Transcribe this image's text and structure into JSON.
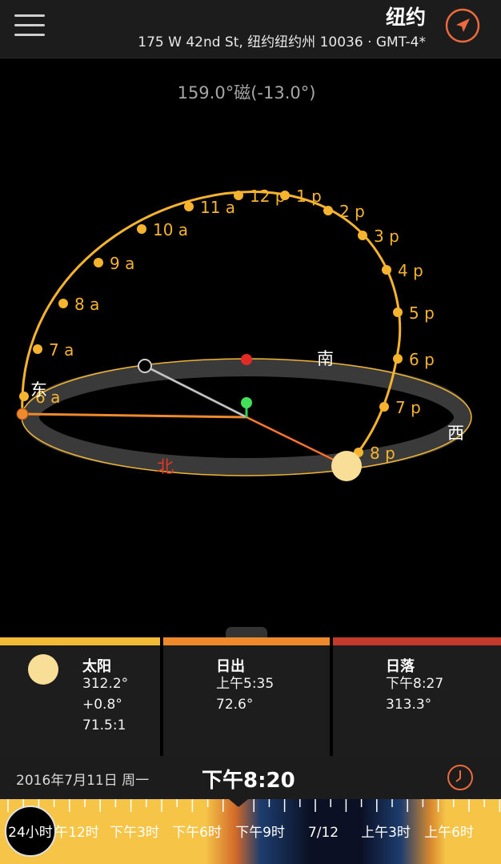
{
  "header": {
    "location_title": "纽约",
    "address": "175 W 42nd St, 纽约纽约州 10036 · GMT-4*",
    "menu_icon": "hamburger-menu-icon",
    "locate_icon": "location-arrow-icon"
  },
  "compass": {
    "heading": "159.0°磁(-13.0°)",
    "directions": {
      "south": "南",
      "west": "西",
      "north": "北",
      "east": "东"
    }
  },
  "sun_path": {
    "hour_labels": [
      "6 a",
      "7 a",
      "8 a",
      "9 a",
      "10 a",
      "11 a",
      "12 p",
      "1 p",
      "2 p",
      "3 p",
      "4 p",
      "5 p",
      "6 p",
      "7 p",
      "8 p"
    ]
  },
  "info_panels": {
    "sun": {
      "label": "太阳",
      "azimuth": "312.2°",
      "altitude": "+0.8°",
      "shadow_ratio": "71.5:1"
    },
    "sunrise": {
      "label": "日出",
      "time": "上午5:35",
      "azimuth": "72.6°"
    },
    "sunset": {
      "label": "日落",
      "time": "下午8:27",
      "azimuth": "313.3°"
    }
  },
  "time_bar": {
    "date": "2016年7月11日 周一",
    "time": "下午8:20",
    "clock_icon": "clock-icon"
  },
  "timeline": {
    "zoom_label": "24小时",
    "labels": [
      "午12时",
      "下午3时",
      "下午6时",
      "下午9时",
      "7/12",
      "上午3时",
      "上午6时"
    ]
  },
  "colors": {
    "sun_path": "#f5b32e",
    "sun": "#f8de96",
    "sunrise": "#ee8a2c",
    "sunset": "#c23a2c",
    "north": "#e53626",
    "accent": "#ee6a3c"
  }
}
